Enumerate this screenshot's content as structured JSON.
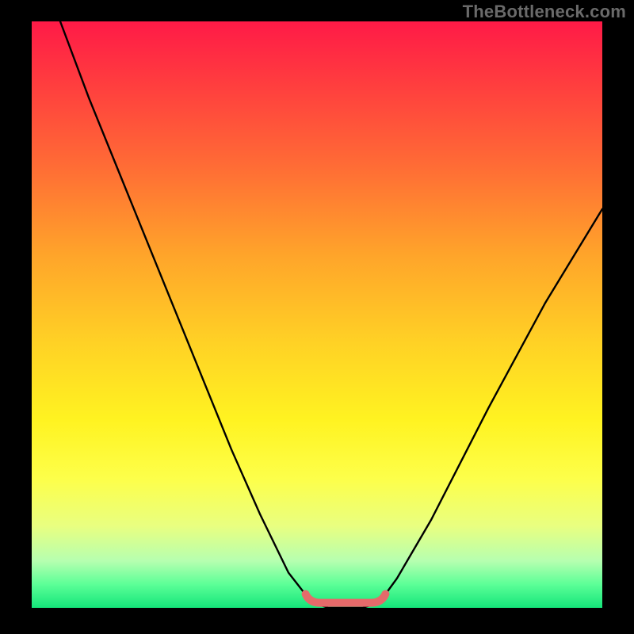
{
  "watermark": "TheBottleneck.com",
  "chart_data": {
    "type": "line",
    "title": "",
    "xlabel": "",
    "ylabel": "",
    "xlim": [
      0,
      100
    ],
    "ylim": [
      0,
      100
    ],
    "grid": false,
    "series": [
      {
        "name": "curve",
        "x": [
          5,
          10,
          15,
          20,
          25,
          30,
          35,
          40,
          45,
          49,
          52,
          55,
          58,
          61,
          64,
          70,
          80,
          90,
          100
        ],
        "y": [
          100,
          87,
          75,
          63,
          51,
          39,
          27,
          16,
          6,
          1,
          0,
          0,
          0,
          1,
          5,
          15,
          34,
          52,
          68
        ],
        "color": "#000000"
      }
    ],
    "annotations": [
      {
        "name": "bottom-pink-segment",
        "x_range": [
          48,
          62
        ],
        "y": 1,
        "color": "#e56a6a"
      }
    ],
    "background": {
      "type": "vertical-gradient",
      "stops": [
        {
          "pos": 0.0,
          "color": "#ff1a47"
        },
        {
          "pos": 0.25,
          "color": "#ff6d35"
        },
        {
          "pos": 0.55,
          "color": "#ffd225"
        },
        {
          "pos": 0.78,
          "color": "#fdff4a"
        },
        {
          "pos": 0.92,
          "color": "#b6ffb0"
        },
        {
          "pos": 1.0,
          "color": "#14e57a"
        }
      ]
    }
  }
}
